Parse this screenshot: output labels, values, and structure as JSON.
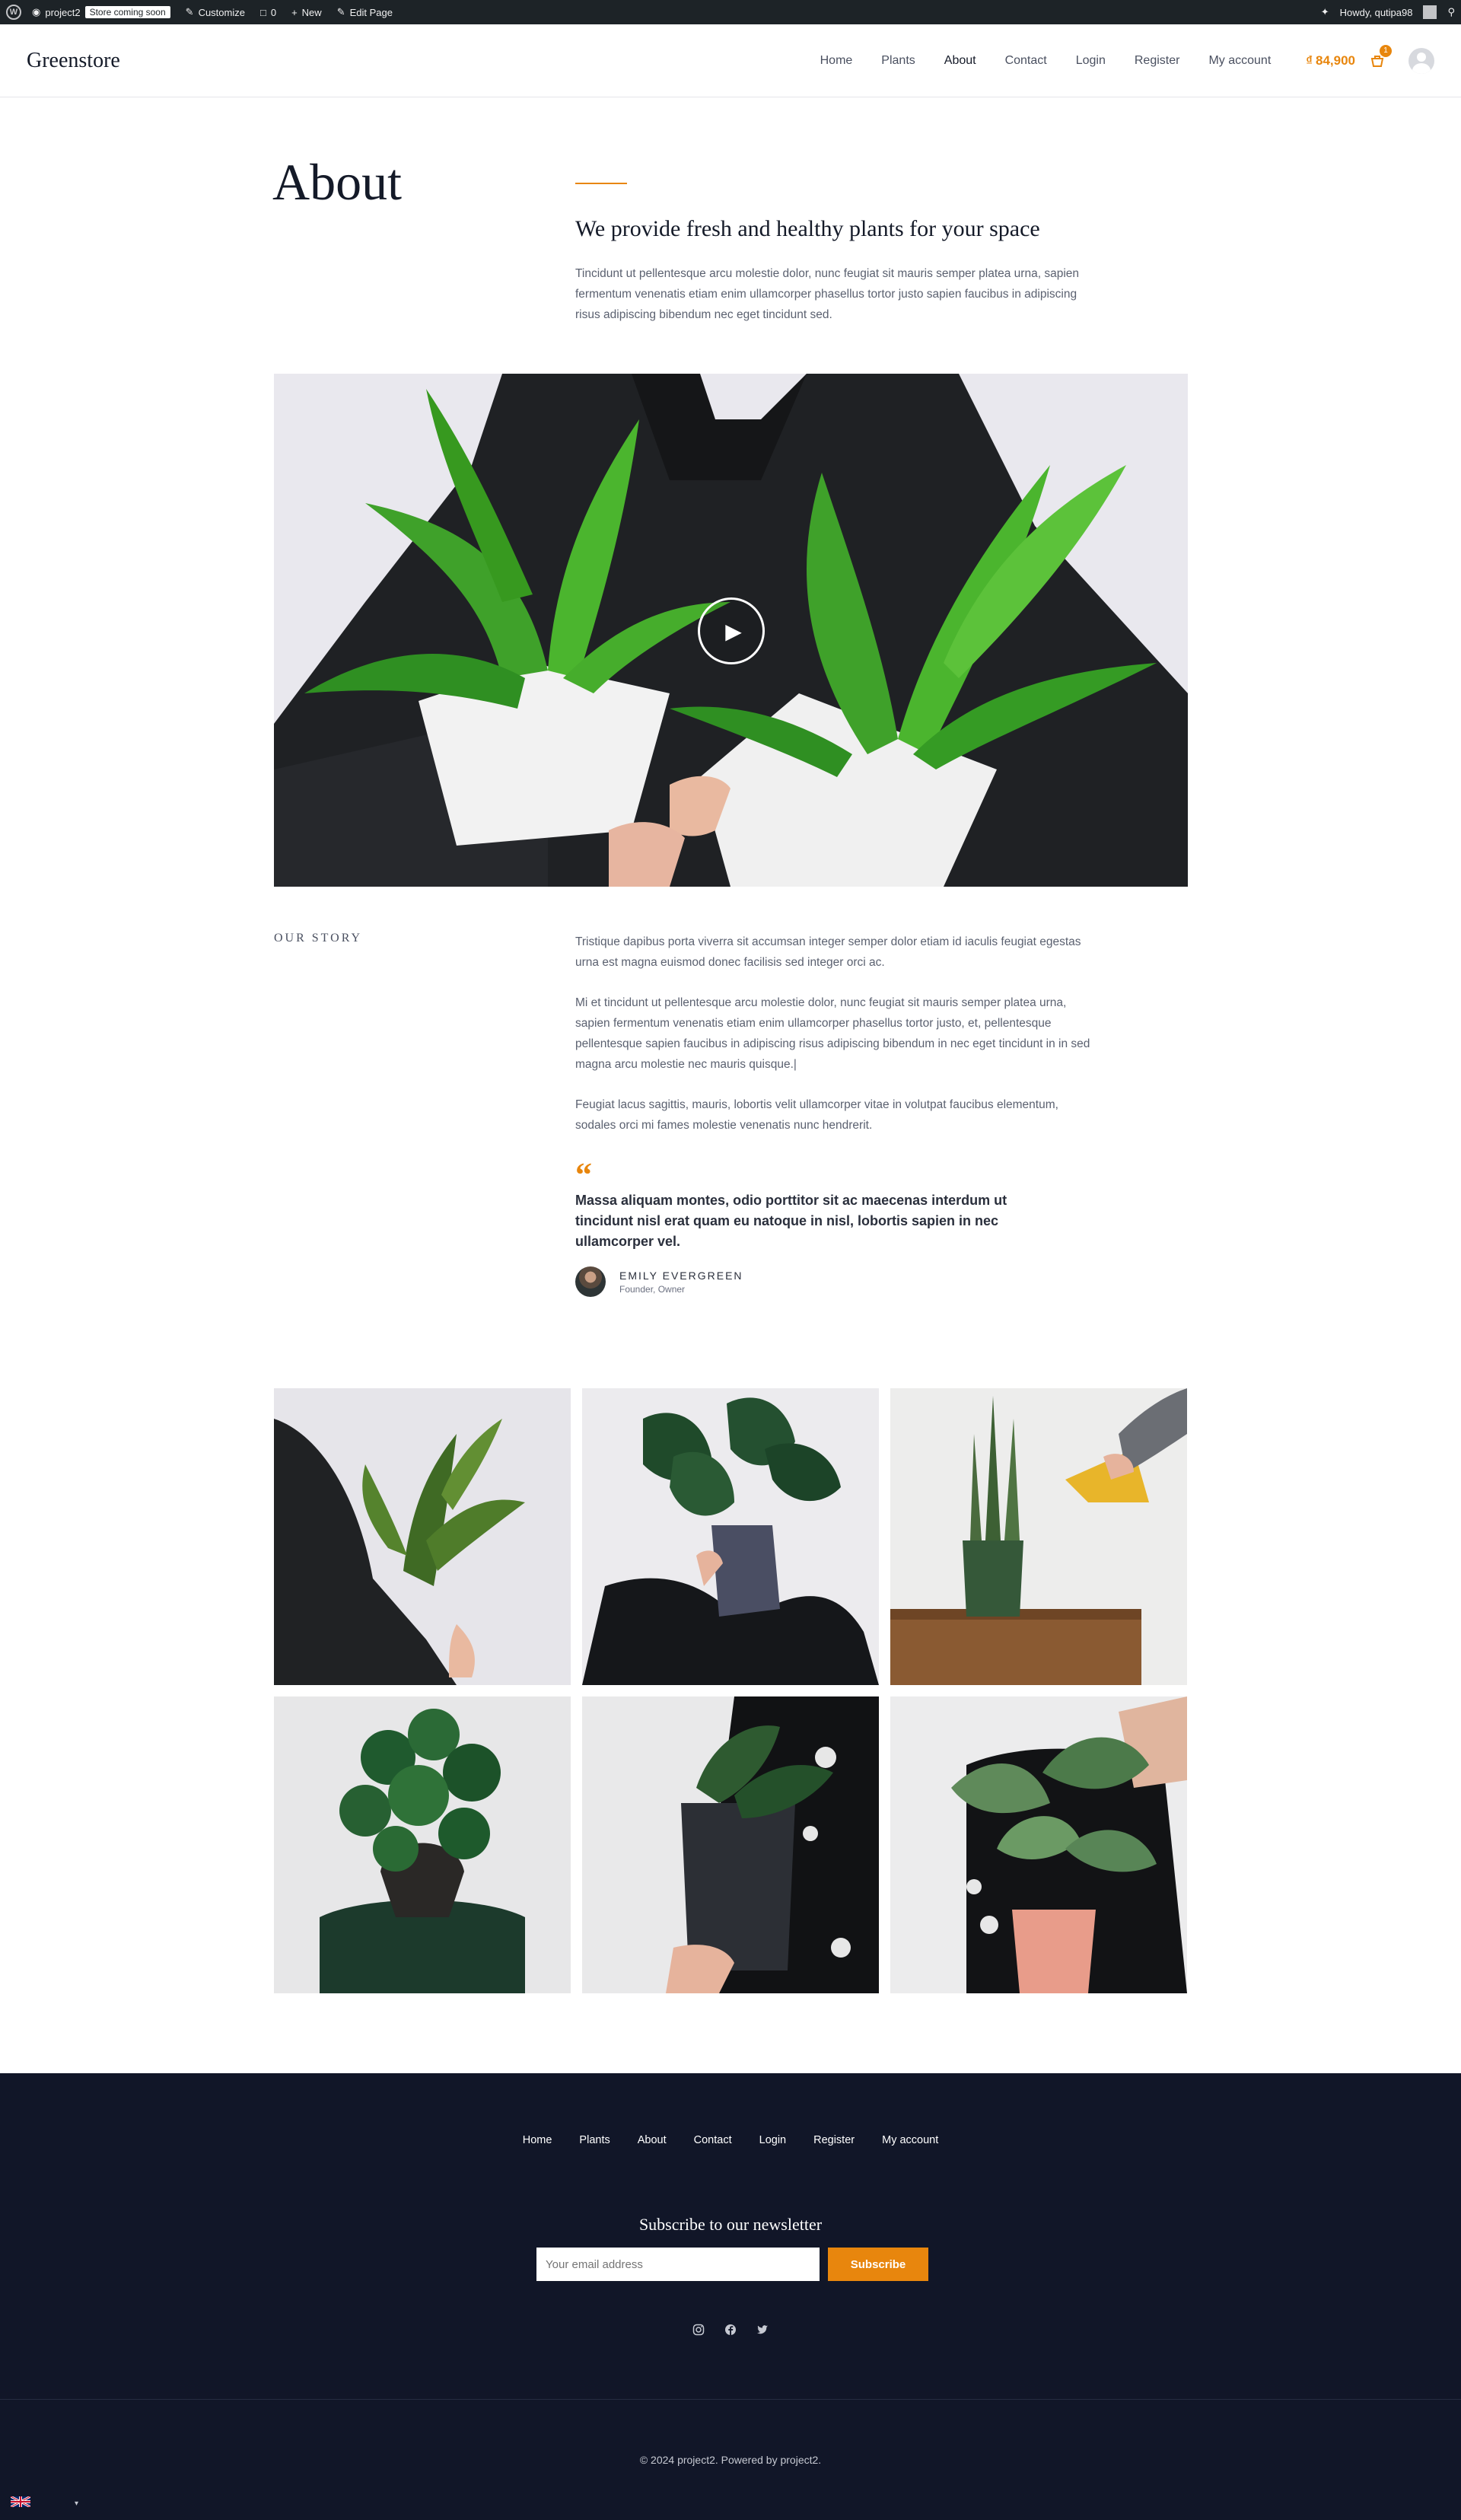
{
  "adminbar": {
    "site_name": "project2",
    "store_badge": "Store coming soon",
    "customize": "Customize",
    "comments_count": "0",
    "new": "New",
    "edit_page": "Edit Page",
    "howdy": "Howdy, qutipa98"
  },
  "header": {
    "logo": "Greenstore",
    "nav": [
      "Home",
      "Plants",
      "About",
      "Contact",
      "Login",
      "Register",
      "My account"
    ],
    "active_nav": "About",
    "cart_amount": "84,900",
    "cart_currency": "₫",
    "cart_count": "1"
  },
  "hero": {
    "title": "About",
    "heading": "We provide fresh and healthy plants for your space",
    "text": "Tincidunt ut pellentesque arcu molestie dolor, nunc feugiat sit mauris semper platea urna, sapien fermentum venenatis etiam enim ullamcorper phasellus tortor justo sapien faucibus in adipiscing risus adipiscing bibendum nec eget tincidunt sed."
  },
  "video": {
    "play_icon": "play-icon"
  },
  "story": {
    "label": "OUR STORY",
    "paragraphs": [
      "Tristique dapibus porta viverra sit accumsan integer semper dolor etiam id iaculis feugiat egestas urna est magna euismod donec facilisis sed integer orci ac.",
      "Mi et tincidunt ut pellentesque arcu molestie dolor, nunc feugiat sit mauris semper platea urna, sapien fermentum venenatis etiam enim ullamcorper phasellus tortor justo, et, pellentesque pellentesque sapien faucibus in adipiscing risus adipiscing bibendum in nec eget tincidunt in in sed magna arcu molestie nec mauris quisque.|",
      "Feugiat lacus sagittis, mauris, lobortis velit ullamcorper vitae in volutpat faucibus elementum, sodales orci mi fames molestie venenatis nunc hendrerit."
    ],
    "quote": "Massa aliquam montes, odio porttitor sit ac maecenas interdum ut tincidunt nisl erat quam eu natoque in nisl, lobortis sapien in nec ullamcorper vel.",
    "author_name": "EMILY EVERGREEN",
    "author_role": "Founder, Owner"
  },
  "footer": {
    "nav": [
      "Home",
      "Plants",
      "About",
      "Contact",
      "Login",
      "Register",
      "My account"
    ],
    "newsletter_title": "Subscribe to our newsletter",
    "email_placeholder": "Your email address",
    "subscribe_label": "Subscribe",
    "social_icons": [
      "instagram-icon",
      "facebook-icon",
      "twitter-icon"
    ],
    "copyright": "© 2024 project2. Powered by project2."
  },
  "colors": {
    "accent": "#e8860d",
    "footer_bg": "#111628",
    "adminbar_bg": "#1d2327",
    "heading": "#141a28"
  }
}
